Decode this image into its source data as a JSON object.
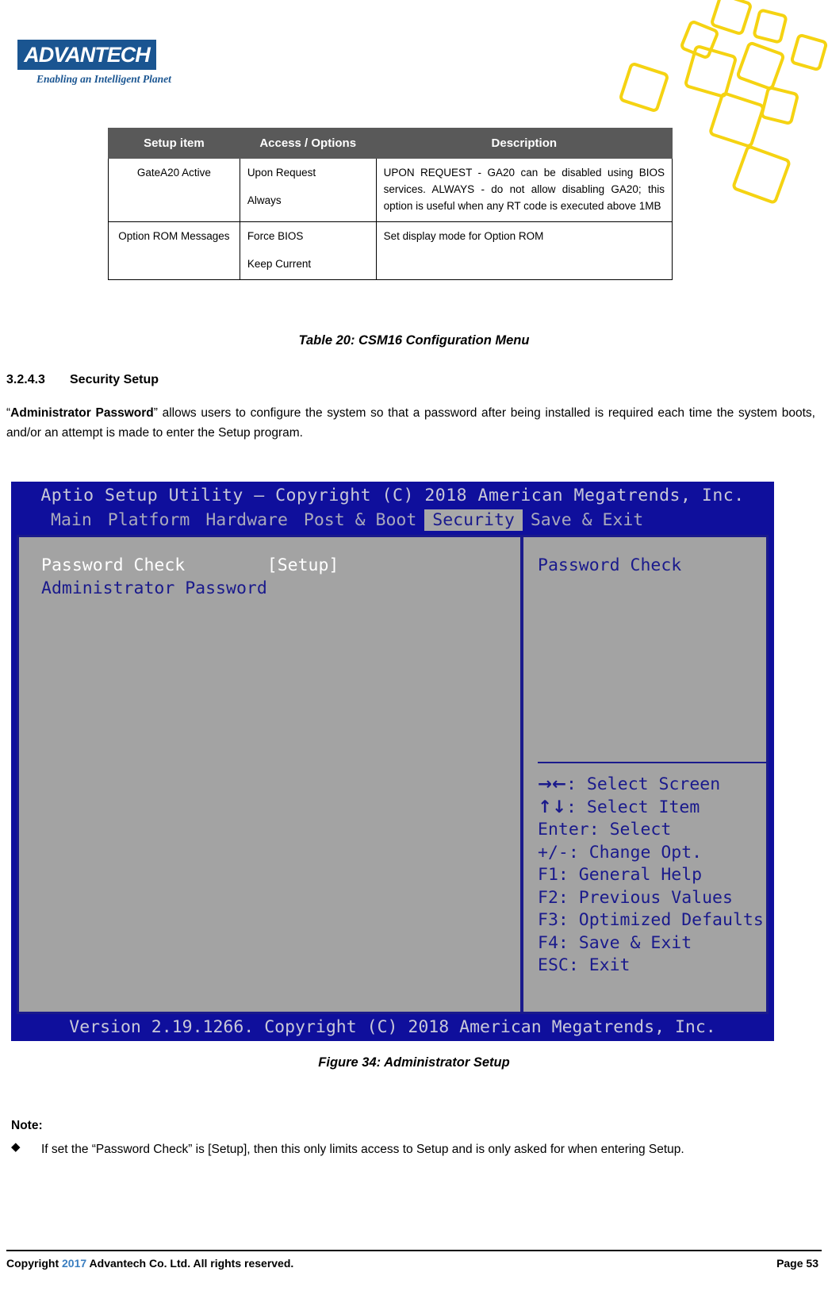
{
  "brand": {
    "logo_text": "ADVANTECH",
    "tagline": "Enabling an Intelligent Planet",
    "logo_bg": "#1a5591",
    "tagline_color": "#1a5591",
    "deco_color": "#f5d312"
  },
  "table": {
    "headers": [
      "Setup item",
      "Access / Options",
      "Description"
    ],
    "header_bg": "#595959",
    "rows": [
      {
        "item": "GateA20 Active",
        "options": [
          "Upon Request",
          "Always"
        ],
        "description": "UPON REQUEST - GA20 can be disabled using BIOS services. ALWAYS - do not allow disabling GA20; this option is useful when any RT code is executed above 1MB"
      },
      {
        "item": "Option ROM Messages",
        "options": [
          "Force BIOS",
          "Keep Current"
        ],
        "description": "Set display mode for Option ROM"
      }
    ],
    "caption": "Table 20: CSM16 Configuration Menu"
  },
  "section": {
    "number": "3.2.4.3",
    "title": "Security Setup",
    "paragraph_pre": "“",
    "paragraph_bold": "Administrator Password",
    "paragraph_post": "” allows users to configure the system so that a password after being installed is required each time the system boots, and/or an attempt is made to enter the Setup program."
  },
  "bios": {
    "title": "Aptio Setup Utility – Copyright (C) 2018 American Megatrends, Inc.",
    "tabs": [
      {
        "label": "Main",
        "active": false
      },
      {
        "label": "Platform",
        "active": false
      },
      {
        "label": "Hardware",
        "active": false
      },
      {
        "label": "Post & Boot",
        "active": false
      },
      {
        "label": "Security",
        "active": true
      },
      {
        "label": "Save & Exit",
        "active": false
      }
    ],
    "settings": [
      {
        "label": "Password Check",
        "value": "[Setup]",
        "selected": true
      },
      {
        "label": "Administrator Password",
        "value": "",
        "selected": false
      }
    ],
    "row_password_check": "Password Check        [Setup]",
    "row_admin_password": "Administrator Password",
    "help_title": "Password Check",
    "help_keys": [
      {
        "glyph": "→←",
        "text": ": Select Screen"
      },
      {
        "glyph": "↑↓",
        "text": ": Select Item"
      },
      {
        "glyph": "",
        "text": "Enter: Select"
      },
      {
        "glyph": "",
        "text": "+/-: Change Opt."
      },
      {
        "glyph": "",
        "text": "F1: General Help"
      },
      {
        "glyph": "",
        "text": "F2: Previous Values"
      },
      {
        "glyph": "",
        "text": "F3: Optimized Defaults"
      },
      {
        "glyph": "",
        "text": "F4: Save & Exit"
      },
      {
        "glyph": "",
        "text": "ESC: Exit"
      }
    ],
    "version": "Version 2.19.1266. Copyright (C) 2018 American Megatrends, Inc.",
    "colors": {
      "chrome_blue": "#0f0f9c",
      "panel_gray": "#a3a3a3",
      "text_blue": "#1a1a8c",
      "text_dim": "#a9a9bb",
      "tab_active_bg": "#a8a8a8"
    },
    "caption": "Figure 34: Administrator Setup"
  },
  "note": {
    "label": "Note:",
    "bullet_glyph": "◆",
    "text": "If set the “Password Check” is [Setup], then this only limits access to Setup and is only asked for when entering Setup."
  },
  "footer": {
    "copyright_word": "Copyright",
    "year": "2017",
    "rest": "Advantech Co. Ltd. All rights reserved.",
    "year_color": "#3a7ec0",
    "page": "Page 53"
  }
}
